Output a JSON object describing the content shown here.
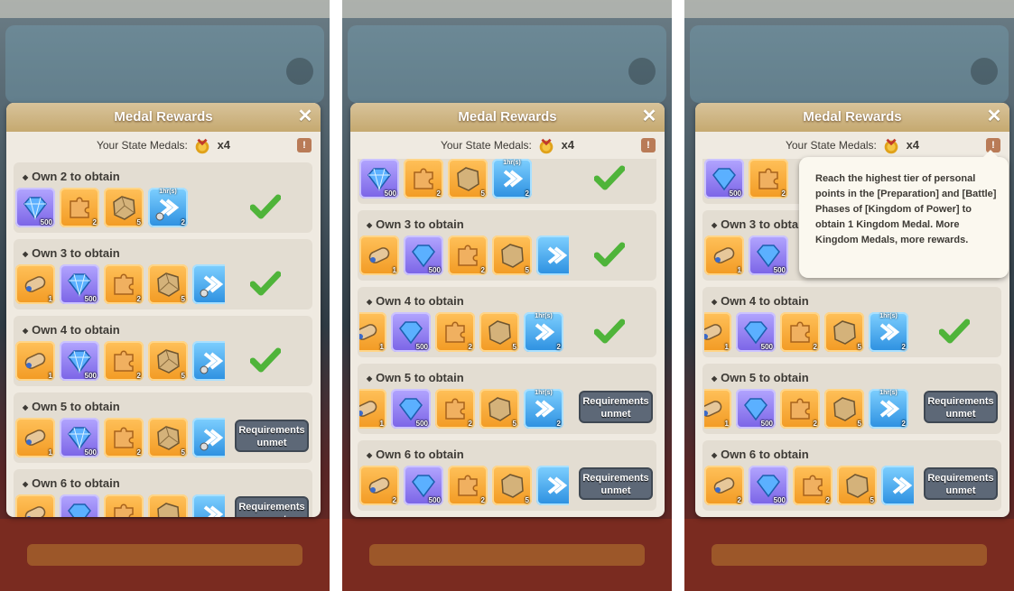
{
  "modal": {
    "title": "Medal Rewards",
    "close_label": "✕"
  },
  "medals": {
    "label": "Your State Medals:",
    "count": "x4",
    "info_label": "!"
  },
  "tier_prefix": "Own",
  "tiers": {
    "t2": {
      "label": "Own 2 to obtain"
    },
    "t3": {
      "label": "Own 3 to obtain"
    },
    "t4": {
      "label": "Own 4 to obtain"
    },
    "t5": {
      "label": "Own 5 to obtain"
    },
    "t6": {
      "label": "Own 6 to obtain"
    }
  },
  "items": {
    "gem": {
      "icon": "blue-gem-icon",
      "qty": "500"
    },
    "puzzle": {
      "icon": "puzzle-piece-icon",
      "qty": "2"
    },
    "stone": {
      "icon": "stone-chunk-icon",
      "qty": "5"
    },
    "speedup": {
      "icon": "speedup-icon",
      "qty": "2",
      "top": "1hr(s)"
    },
    "scroll": {
      "icon": "scroll-icon",
      "qty": "1"
    },
    "scroll2": {
      "icon": "scroll-icon",
      "qty": "2"
    }
  },
  "requirements_button": "Requirements unmet",
  "tooltip": {
    "text": "Reach the highest tier of personal points in the [Preparation] and [Battle] Phases of [Kingdom of Power] to obtain 1 Kingdom Medal. More Kingdom Medals, more rewards."
  },
  "colors": {
    "header": "#c9ad74",
    "check": "#4fb43a",
    "button": "#5d6877"
  }
}
